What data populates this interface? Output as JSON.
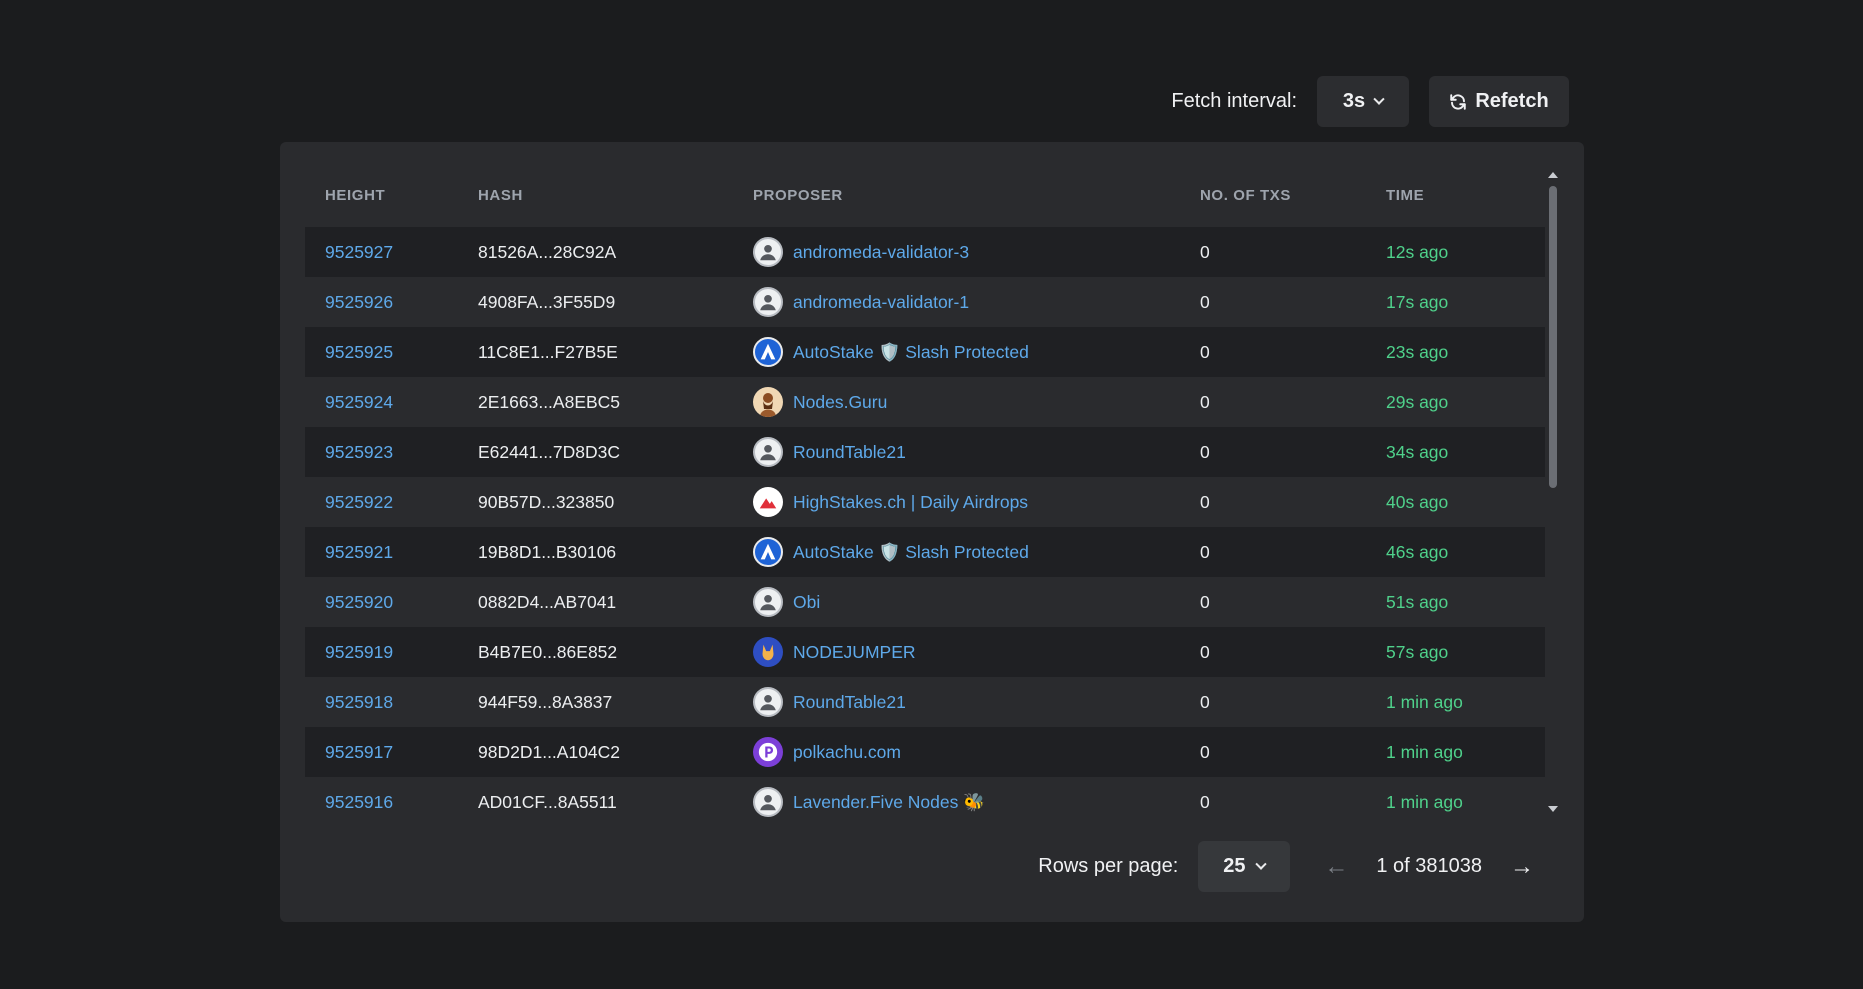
{
  "toolbar": {
    "fetch_label": "Fetch interval:",
    "fetch_value": "3s",
    "refetch_label": "Refetch"
  },
  "table": {
    "columns": [
      "HEIGHT",
      "HASH",
      "PROPOSER",
      "NO. OF TXS",
      "TIME"
    ],
    "rows": [
      {
        "height": "9525927",
        "hash": "81526A...28C92A",
        "proposer": "andromeda-validator-3",
        "avatar": "default-user-icon",
        "txs": "0",
        "time": "12s ago"
      },
      {
        "height": "9525926",
        "hash": "4908FA...3F55D9",
        "proposer": "andromeda-validator-1",
        "avatar": "default-user-icon",
        "txs": "0",
        "time": "17s ago"
      },
      {
        "height": "9525925",
        "hash": "11C8E1...F27B5E",
        "proposer": "AutoStake 🛡️ Slash Protected",
        "avatar": "autostake-logo",
        "txs": "0",
        "time": "23s ago"
      },
      {
        "height": "9525924",
        "hash": "2E1663...A8EBC5",
        "proposer": "Nodes.Guru",
        "avatar": "nodes-guru-logo",
        "txs": "0",
        "time": "29s ago"
      },
      {
        "height": "9525923",
        "hash": "E62441...7D8D3C",
        "proposer": "RoundTable21",
        "avatar": "default-user-icon",
        "txs": "0",
        "time": "34s ago"
      },
      {
        "height": "9525922",
        "hash": "90B57D...323850",
        "proposer": "HighStakes.ch | Daily Airdrops",
        "avatar": "highstakes-logo",
        "txs": "0",
        "time": "40s ago"
      },
      {
        "height": "9525921",
        "hash": "19B8D1...B30106",
        "proposer": "AutoStake 🛡️ Slash Protected",
        "avatar": "autostake-logo",
        "txs": "0",
        "time": "46s ago"
      },
      {
        "height": "9525920",
        "hash": "0882D4...AB7041",
        "proposer": "Obi",
        "avatar": "default-user-icon",
        "txs": "0",
        "time": "51s ago"
      },
      {
        "height": "9525919",
        "hash": "B4B7E0...86E852",
        "proposer": "NODEJUMPER",
        "avatar": "nodejumper-logo",
        "txs": "0",
        "time": "57s ago"
      },
      {
        "height": "9525918",
        "hash": "944F59...8A3837",
        "proposer": "RoundTable21",
        "avatar": "default-user-icon",
        "txs": "0",
        "time": "1 min ago"
      },
      {
        "height": "9525917",
        "hash": "98D2D1...A104C2",
        "proposer": "polkachu.com",
        "avatar": "polkachu-logo",
        "txs": "0",
        "time": "1 min ago"
      },
      {
        "height": "9525916",
        "hash": "AD01CF...8A5511",
        "proposer": "Lavender.Five Nodes 🐝",
        "avatar": "default-user-icon",
        "txs": "0",
        "time": "1 min ago"
      }
    ]
  },
  "pagination": {
    "rows_label": "Rows per page:",
    "rows_value": "25",
    "page_info": "1 of 381038"
  },
  "colors": {
    "background": "#1b1c1e",
    "panel": "#2a2b2e",
    "link": "#5ea9ea",
    "time": "#4fd18b"
  }
}
